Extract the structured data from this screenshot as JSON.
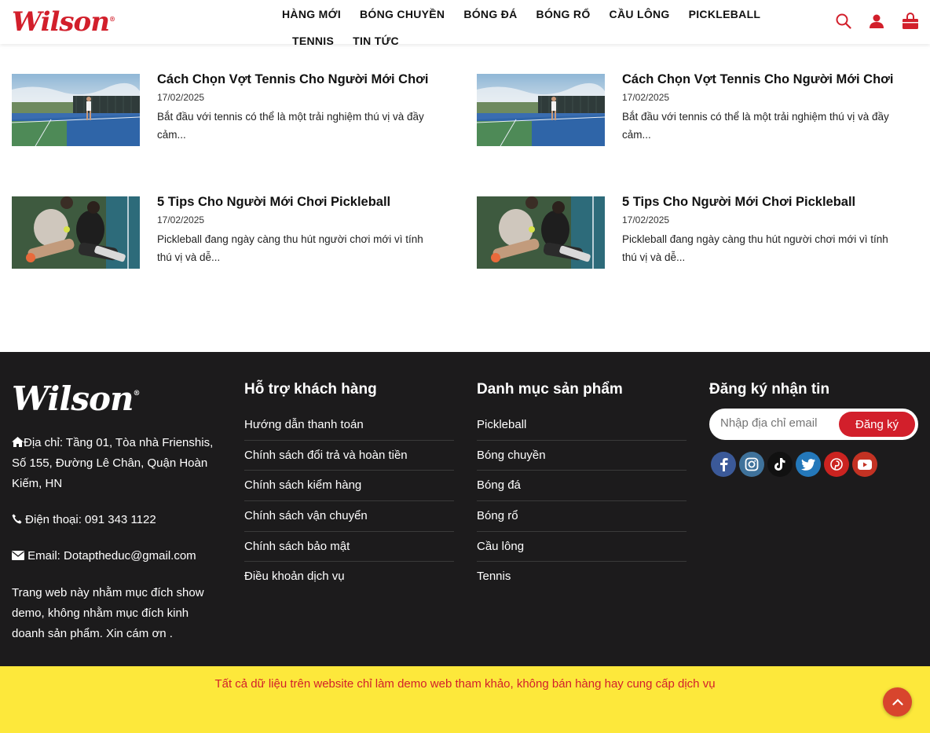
{
  "brand": {
    "logo_text": "Wilson",
    "accent": "#d21f2b"
  },
  "nav": {
    "row1": [
      "HÀNG MỚI",
      "BÓNG CHUYỀN",
      "BÓNG ĐÁ",
      "BÓNG RỔ",
      "CẦU LÔNG",
      "PICKLEBALL"
    ],
    "row2": [
      "TENNIS",
      "TIN TỨC"
    ],
    "icons": [
      "search-icon",
      "user-icon",
      "shopping-bag-icon"
    ]
  },
  "posts": [
    {
      "title": "Cách Chọn Vợt Tennis Cho Người Mới Chơi",
      "date": "17/02/2025",
      "excerpt": "Bắt đầu với tennis có thể là một trải nghiệm thú vị và đầy cảm..."
    },
    {
      "title": "Cách Chọn Vợt Tennis Cho Người Mới Chơi",
      "date": "17/02/2025",
      "excerpt": "Bắt đầu với tennis có thể là một trải nghiệm thú vị và đầy cảm..."
    },
    {
      "title": "5 Tips Cho Người Mới Chơi Pickleball",
      "date": "17/02/2025",
      "excerpt": "Pickleball đang ngày càng thu hút người chơi mới vì tính thú vị và dễ..."
    },
    {
      "title": "5 Tips Cho Người Mới Chơi Pickleball",
      "date": "17/02/2025",
      "excerpt": "Pickleball đang ngày càng thu hút người chơi mới vì tính thú vị và dễ..."
    }
  ],
  "footer": {
    "logo_text": "Wilson",
    "address": "Địa chỉ: Tầng 01, Tòa nhà Frienshis, Số 155, Đường Lê Chân, Quận Hoàn Kiếm, HN",
    "phone": "Điện thoại: 091 343 1122",
    "email": "Email: Dotaptheduc@gmail.com",
    "note": "Trang web này nhằm mục đích show demo, không nhằm mục đích kinh doanh sản phẩm. Xin cám ơn .",
    "support": {
      "heading": "Hỗ trợ khách hàng",
      "items": [
        "Hướng dẫn thanh toán",
        "Chính sách đổi trả và hoàn tiền",
        "Chính sách kiểm hàng",
        "Chính sách vận chuyển",
        "Chính sách bảo mật",
        "Điều khoản dịch vụ"
      ]
    },
    "categories": {
      "heading": "Danh mục sản phẩm",
      "items": [
        "Pickleball",
        "Bóng chuyền",
        "Bóng đá",
        "Bóng rổ",
        "Cầu lông",
        "Tennis"
      ]
    },
    "newsletter": {
      "heading": "Đăng ký nhận tin",
      "placeholder": "Nhập địa chỉ email",
      "button": "Đăng ký"
    },
    "socials": [
      {
        "name": "facebook",
        "color": "#3b5998"
      },
      {
        "name": "instagram",
        "color": "#3f729b"
      },
      {
        "name": "tiktok",
        "color": "#111111"
      },
      {
        "name": "twitter",
        "color": "#2478ba"
      },
      {
        "name": "pinterest",
        "color": "#cb2320"
      },
      {
        "name": "youtube",
        "color": "#c33223"
      }
    ]
  },
  "bottom_bar": {
    "text": "Tất cả dữ liệu trên website chỉ làm demo web tham khảo, không bán hàng hay cung cấp dịch vụ",
    "bg": "#fde83b"
  }
}
